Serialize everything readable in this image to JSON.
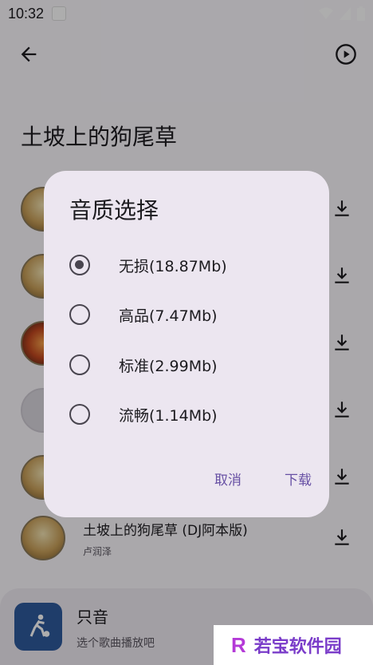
{
  "status_bar": {
    "time": "10:32"
  },
  "page": {
    "title": "土坡上的狗尾草"
  },
  "songs": [
    {
      "title": "",
      "artist": ""
    },
    {
      "title": "",
      "artist": ""
    },
    {
      "title": "",
      "artist": ""
    },
    {
      "title": "",
      "artist": ""
    },
    {
      "title": "",
      "artist": ""
    },
    {
      "title": "土坡上的狗尾草 (DJ阿本版)",
      "artist": "卢润泽"
    }
  ],
  "player": {
    "title": "只音",
    "subtitle": "选个歌曲播放吧"
  },
  "dialog": {
    "title": "音质选择",
    "options": [
      {
        "label": "无损(18.87Mb)",
        "selected": true
      },
      {
        "label": "高品(7.47Mb)",
        "selected": false
      },
      {
        "label": "标准(2.99Mb)",
        "selected": false
      },
      {
        "label": "流畅(1.14Mb)",
        "selected": false
      }
    ],
    "cancel_label": "取消",
    "confirm_label": "下载"
  },
  "watermark": {
    "logo": "R",
    "text": "若宝软件园"
  },
  "colors": {
    "accent": "#6750a4",
    "dialog_bg": "#ece6f0"
  }
}
